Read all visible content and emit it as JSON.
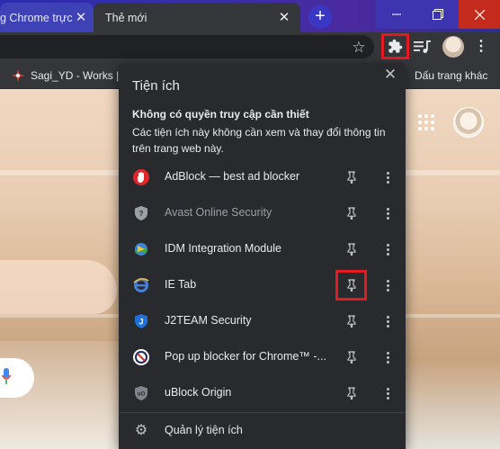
{
  "tabs": [
    {
      "title": "g Chrome trực",
      "active": false
    },
    {
      "title": "Thẻ mới",
      "active": true
    }
  ],
  "toolbar": {
    "bookmark_icon": "star-icon",
    "extensions_icon": "puzzle-icon",
    "media_icon": "media-control-icon",
    "menu_icon": "kebab-menu-icon"
  },
  "bookmarks": {
    "items": [
      {
        "label": "Sagi_YD - Works |"
      }
    ],
    "other": "Dấu trang khác"
  },
  "popup": {
    "title": "Tiện ích",
    "section_heading": "Không có quyền truy cập cần thiết",
    "section_desc": "Các tiện ích này không cần xem và thay đổi thông tin trên trang web này.",
    "extensions": [
      {
        "name": "AdBlock — best ad blocker",
        "icon": "adblock-icon",
        "color": "#e0262b",
        "enabled": true
      },
      {
        "name": "Avast Online Security",
        "icon": "avast-shield-icon",
        "color": "#9aa0a6",
        "enabled": false
      },
      {
        "name": "IDM Integration Module",
        "icon": "idm-globe-icon",
        "color": "#2e8b3e",
        "enabled": true
      },
      {
        "name": "IE Tab",
        "icon": "ie-tab-icon",
        "color": "#4a7fd8",
        "enabled": true,
        "pin_highlighted": true
      },
      {
        "name": "J2TEAM Security",
        "icon": "j2team-shield-icon",
        "color": "#1e6fd9",
        "enabled": true
      },
      {
        "name": "Pop up blocker for Chrome™ -...",
        "icon": "popup-blocker-icon",
        "color": "#d93025",
        "enabled": true
      },
      {
        "name": "uBlock Origin",
        "icon": "ublock-icon",
        "color": "#80868b",
        "enabled": true
      }
    ],
    "manage_label": "Quản lý tiện ích"
  },
  "colors": {
    "highlight": "#e21b23",
    "popup_bg": "#292a2d",
    "toolbar_bg": "#35363a"
  }
}
